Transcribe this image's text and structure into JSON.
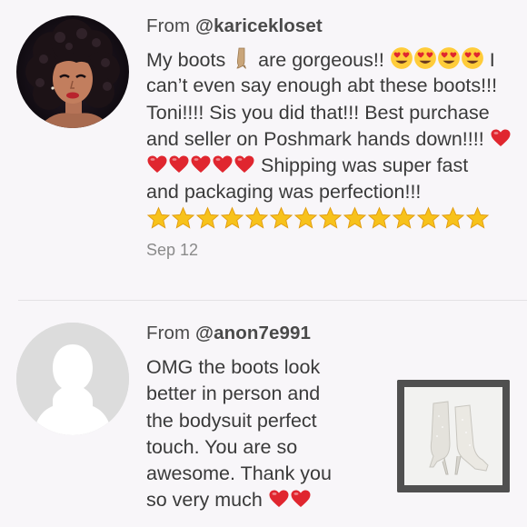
{
  "reviews": [
    {
      "from_prefix": "From ",
      "handle": "@karicekloset",
      "lines": [
        [
          "My boots ",
          "boot-emoji",
          " are gorgeous!! ",
          "heart-eyes-emoji",
          "heart-eyes-emoji",
          "heart-eyes-emoji",
          "heart-eyes-emoji",
          " I"
        ],
        [
          "can’t even say enough abt these boots!!! "
        ],
        [
          "Toni!!!! Sis you did that!!! Best purchase"
        ],
        [
          "and seller on Poshmark hands down!!!! ",
          "red-heart-emoji"
        ],
        [
          "red-heart-emoji",
          "red-heart-emoji",
          "red-heart-emoji",
          "red-heart-emoji",
          "red-heart-emoji",
          " Shipping was super fast"
        ],
        [
          "and packaging was perfection!!!"
        ],
        [
          "star-emoji",
          "star-emoji",
          "star-emoji",
          "star-emoji",
          "star-emoji",
          "star-emoji",
          "star-emoji",
          "star-emoji",
          "star-emoji",
          "star-emoji",
          "star-emoji",
          "star-emoji",
          "star-emoji",
          "star-emoji"
        ]
      ],
      "date": "Sep 12"
    },
    {
      "from_prefix": "From ",
      "handle": "@anon7e991",
      "lines": [
        [
          "OMG the boots look"
        ],
        [
          "better in person and"
        ],
        [
          "the bodysuit perfect"
        ],
        [
          "touch. You are so"
        ],
        [
          "awesome. Thank you"
        ],
        [
          "so very much ",
          "red-heart-emoji",
          "red-heart-emoji"
        ]
      ]
    }
  ],
  "colors": {
    "background": "#f8f6f9",
    "text": "#3a3a3a",
    "date": "#8a8a8a",
    "heart": "#e0262f",
    "star": "#f7c21b"
  }
}
